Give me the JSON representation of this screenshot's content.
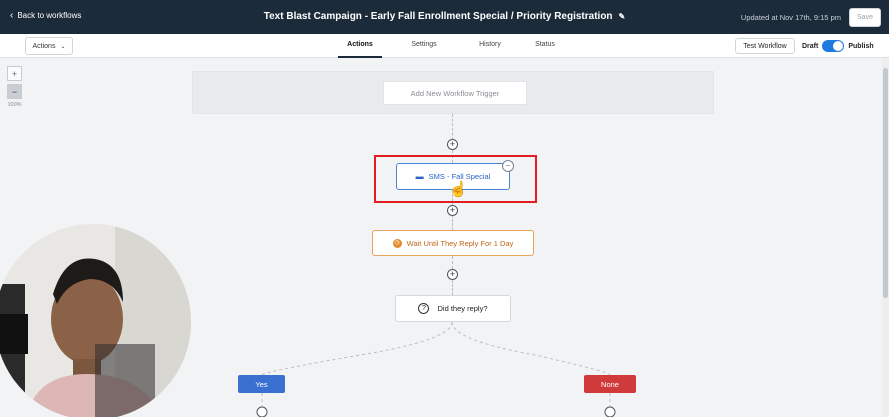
{
  "header": {
    "back_label": "Back to workflows",
    "title": "Text Blast Campaign - Early Fall Enrollment Special / Priority Registration",
    "updated": "Updated at Nov 17th, 9:15 pm",
    "save_label": "Save"
  },
  "toolbar": {
    "actions_label": "Actions",
    "tabs": [
      {
        "label": "Actions",
        "active": true
      },
      {
        "label": "Settings",
        "active": false
      },
      {
        "label": "History",
        "active": false
      },
      {
        "label": "Status",
        "active": false
      }
    ],
    "test_label": "Test Workflow",
    "draft_label": "Draft",
    "publish_label": "Publish",
    "publish_on": true
  },
  "zoom": {
    "plus": "+",
    "minus": "−",
    "level": "100%"
  },
  "canvas": {
    "trigger_label": "Add New Workflow Trigger",
    "sms_label": "SMS - Fall Special",
    "wait_label": "Wait Until They Reply For 1 Day",
    "question_label": "Did they reply?",
    "yes_label": "Yes",
    "none_label": "None"
  },
  "colors": {
    "header_bg": "#1c2b3a",
    "accent_blue": "#1f7ae0",
    "highlight_red": "#e11d24",
    "wait_orange": "#e48a2a",
    "yes_blue": "#3b6fd0",
    "none_red": "#d13a3a"
  }
}
